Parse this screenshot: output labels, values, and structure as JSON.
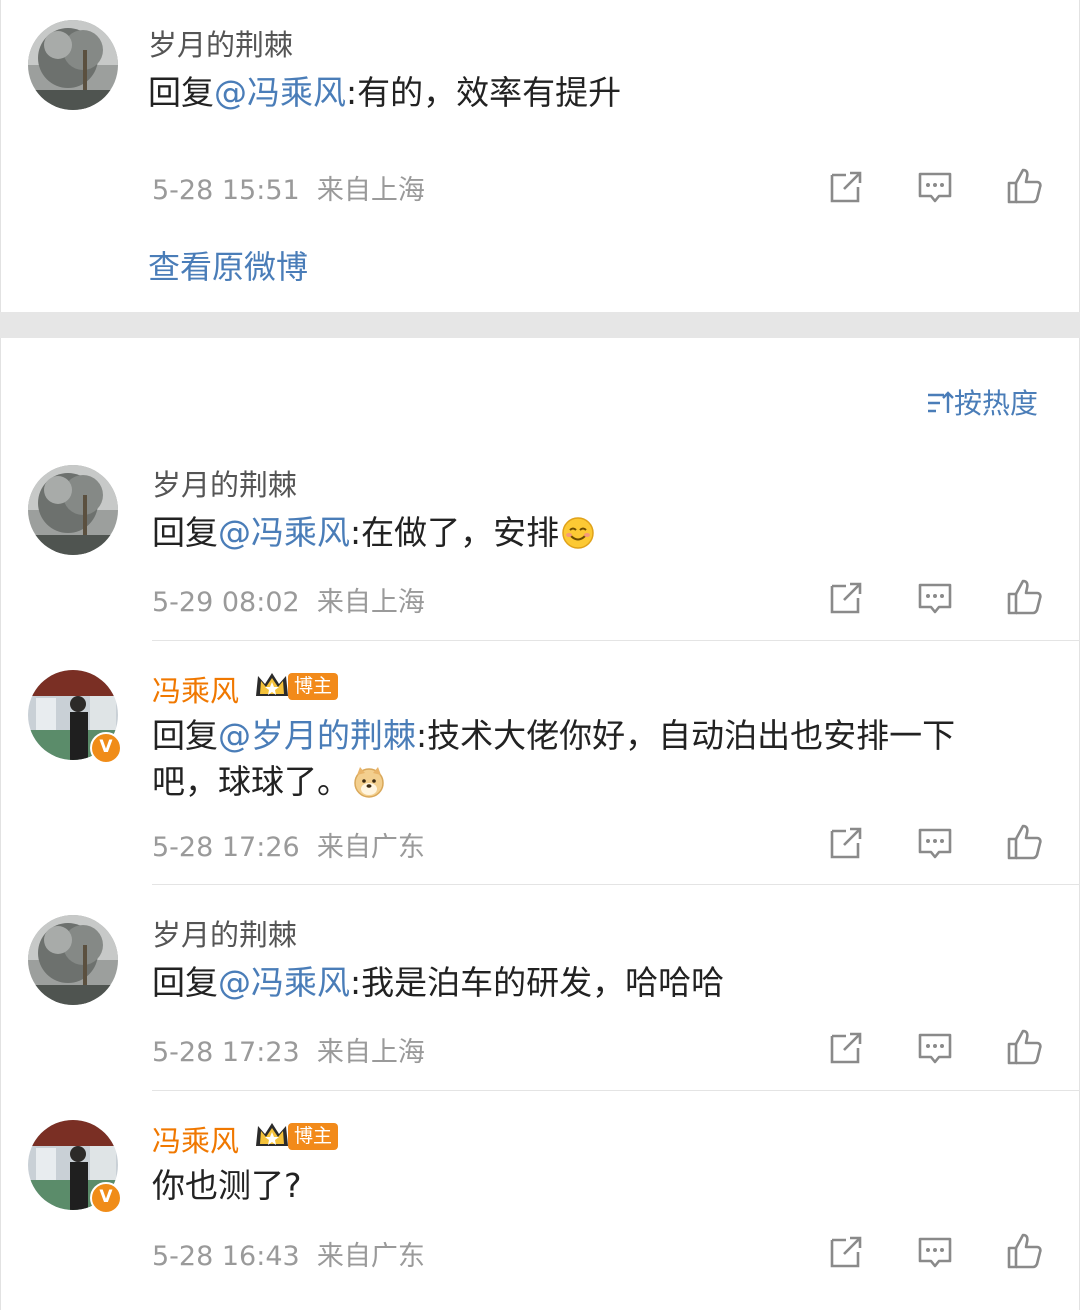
{
  "top_comment": {
    "username": "岁月的荆棘",
    "reply_prefix": "回复",
    "mention": "@冯乘风",
    "text": ":有的，效率有提升",
    "timestamp": "5-28 15:51",
    "location": "来自上海",
    "view_original": "查看原微博"
  },
  "sort": {
    "label": "按热度"
  },
  "comments": [
    {
      "username": "岁月的荆棘",
      "reply_prefix": "回复",
      "mention": "@冯乘风",
      "text": ":在做了，安排",
      "emoji": "smile-emoji",
      "timestamp": "5-29 08:02",
      "location": "来自上海"
    },
    {
      "username": "冯乘风",
      "tag": "博主",
      "verified": "V",
      "reply_prefix": "回复",
      "mention": "@岁月的荆棘",
      "text_line1": ":技术大佬你好，自动泊出也安排一下",
      "text_line2": "吧，球球了。",
      "emoji": "doge-emoji",
      "timestamp": "5-28 17:26",
      "location": "来自广东"
    },
    {
      "username": "岁月的荆棘",
      "reply_prefix": "回复",
      "mention": "@冯乘风",
      "text": ":我是泊车的研发，哈哈哈",
      "timestamp": "5-28 17:23",
      "location": "来自上海"
    },
    {
      "username": "冯乘风",
      "tag": "博主",
      "verified": "V",
      "text": "你也测了?",
      "timestamp": "5-28 16:43",
      "location": "来自广东"
    }
  ],
  "icons": {
    "share": "share-icon",
    "comment": "comment-icon",
    "like": "like-icon",
    "sort": "sort-icon",
    "crown": "crown-icon"
  },
  "colors": {
    "link": "#4a7db8",
    "blogger_name": "#f07800",
    "tag_bg": "#f28a1a",
    "meta": "#9a9a9a"
  }
}
